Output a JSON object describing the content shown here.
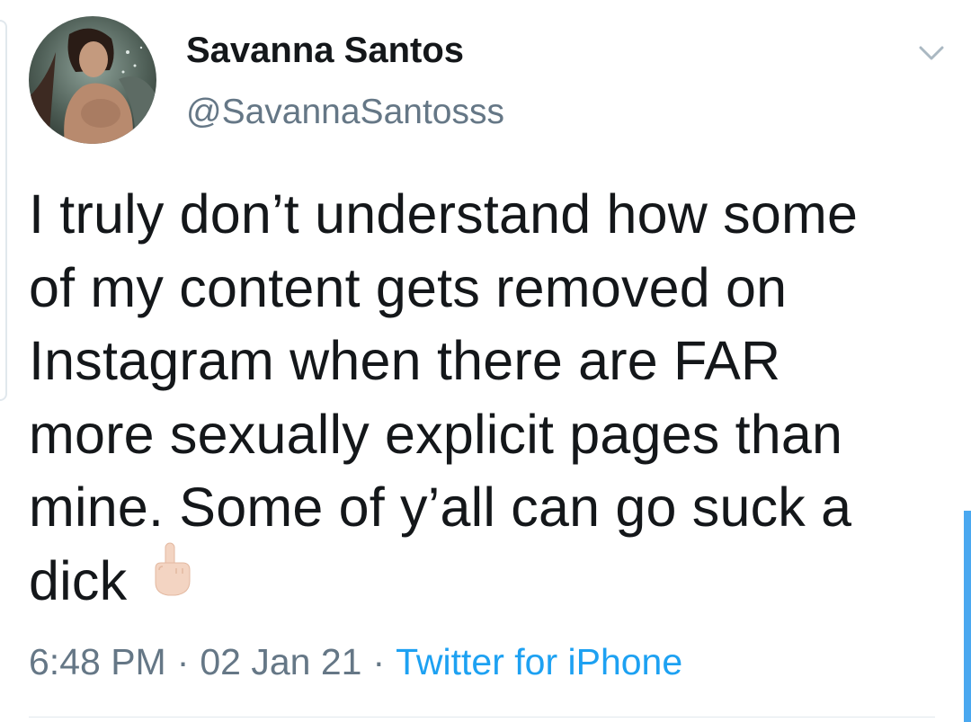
{
  "tweet": {
    "author": {
      "display_name": "Savanna Santos",
      "handle": "@SavannaSantosss"
    },
    "text_lines": [
      "I truly don’t understand how some",
      "of my content gets removed on",
      "Instagram when there are FAR",
      "more sexually explicit pages than",
      "mine. Some of y’all can go suck a",
      "dick"
    ],
    "emoji": "middle-finger-light-skin-tone",
    "time": "6:48 PM",
    "separator": "·",
    "date": "02 Jan 21",
    "source": "Twitter for iPhone"
  },
  "icons": {
    "menu": "chevron-down-icon"
  },
  "colors": {
    "text": "#14171a",
    "secondary": "#657786",
    "link": "#1da1f2"
  }
}
